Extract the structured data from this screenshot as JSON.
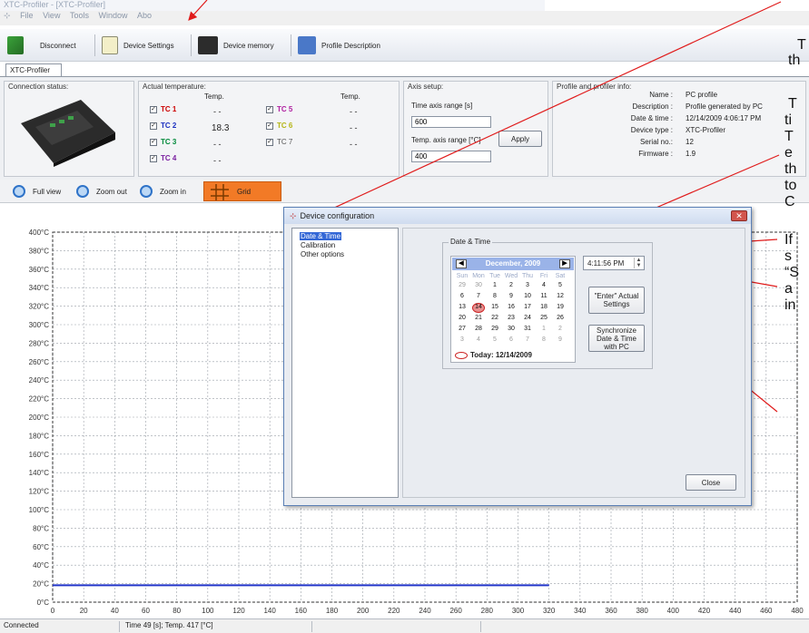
{
  "window": {
    "title": "XTC-Profiler - [XTC-Profiler]",
    "menu": [
      "File",
      "View",
      "Tools",
      "Window",
      "Abo"
    ]
  },
  "toolbar": {
    "disconnect": "Disconnect",
    "device_settings": "Device Settings",
    "device_memory": "Device memory",
    "profile_description": "Profile Description"
  },
  "tab": "XTC-Profiler",
  "connection": {
    "title": "Connection status:"
  },
  "temperature": {
    "title": "Actual temperature:",
    "col_header": "Temp.",
    "channels": [
      {
        "name": "TC 1",
        "value": "- -",
        "color": "#cc0000"
      },
      {
        "name": "TC 2",
        "value": "18.3",
        "color": "#1a2fc0"
      },
      {
        "name": "TC 3",
        "value": "- -",
        "color": "#008a3a"
      },
      {
        "name": "TC 4",
        "value": "- -",
        "color": "#7a1fa0"
      },
      {
        "name": "TC 5",
        "value": "- -",
        "color": "#b020a0"
      },
      {
        "name": "TC 6",
        "value": "- -",
        "color": "#b5b515"
      },
      {
        "name": "TC 7",
        "value": "- -",
        "color": "#555555"
      }
    ]
  },
  "axis_setup": {
    "title": "Axis setup:",
    "time_label": "Time axis range [s]",
    "time_value": "600",
    "temp_label": "Temp. axis range [°C]",
    "temp_value": "400",
    "apply": "Apply"
  },
  "profile_info": {
    "title": "Profile and profiler info:",
    "rows": [
      {
        "label": "Name :",
        "value": "PC profile"
      },
      {
        "label": "Description :",
        "value": "Profile generated by PC"
      },
      {
        "label": "Date & time :",
        "value": "12/14/2009 4:06:17 PM"
      },
      {
        "label": "Device type :",
        "value": "XTC-Profiler"
      },
      {
        "label": "Serial no.:",
        "value": "12"
      },
      {
        "label": "Firmware :",
        "value": "1.9"
      }
    ]
  },
  "graph_toolbar": {
    "full_view": "Full view",
    "zoom_out": "Zoom out",
    "zoom_in": "Zoom in",
    "grid": "Grid"
  },
  "chart_data": {
    "type": "line",
    "title": "",
    "xlabel": "",
    "ylabel": "",
    "xlim": [
      0,
      480
    ],
    "ylim": [
      0,
      400
    ],
    "x_ticks": [
      0,
      20,
      40,
      60,
      80,
      100,
      120,
      140,
      160,
      180,
      200,
      220,
      240,
      260,
      280,
      300,
      320,
      340,
      360,
      380,
      400,
      420,
      440,
      460,
      480
    ],
    "y_ticks": [
      "0°C",
      "20°C",
      "40°C",
      "60°C",
      "80°C",
      "100°C",
      "120°C",
      "140°C",
      "160°C",
      "180°C",
      "200°C",
      "220°C",
      "240°C",
      "260°C",
      "280°C",
      "300°C",
      "320°C",
      "340°C",
      "360°C",
      "380°C",
      "400°C"
    ],
    "grid": true,
    "series": [
      {
        "color": "#2235c9",
        "x": [
          0,
          320
        ],
        "y": [
          18.3,
          18.3
        ]
      }
    ]
  },
  "status": {
    "state": "Connected",
    "readout": "Time 49 [s]; Temp. 417 [°C]"
  },
  "dialog": {
    "title": "Device configuration",
    "nav": [
      "Date & Time",
      "Calibration",
      "Other options"
    ],
    "group_title": "Date & Time",
    "calendar": {
      "month": "December, 2009",
      "day_names": [
        "Sun",
        "Mon",
        "Tue",
        "Wed",
        "Thu",
        "Fri",
        "Sat"
      ],
      "weeks": [
        [
          "29",
          "30",
          "1",
          "2",
          "3",
          "4",
          "5"
        ],
        [
          "6",
          "7",
          "8",
          "9",
          "10",
          "11",
          "12"
        ],
        [
          "13",
          "14",
          "15",
          "16",
          "17",
          "18",
          "19"
        ],
        [
          "20",
          "21",
          "22",
          "23",
          "24",
          "25",
          "26"
        ],
        [
          "27",
          "28",
          "29",
          "30",
          "31",
          "1",
          "2"
        ],
        [
          "3",
          "4",
          "5",
          "6",
          "7",
          "8",
          "9"
        ]
      ],
      "selected": "14",
      "today": "Today: 12/14/2009"
    },
    "time": "4:11:56 PM",
    "enter_button": "\"Enter\" Actual Settings",
    "sync_button": "Synchronize Date & Time with PC",
    "close": "Close"
  },
  "annotations": [
    "T",
    "th",
    "T",
    "ti",
    "T",
    "e",
    "th",
    "to",
    "C",
    "If",
    "s",
    "“S",
    "a",
    "in"
  ]
}
